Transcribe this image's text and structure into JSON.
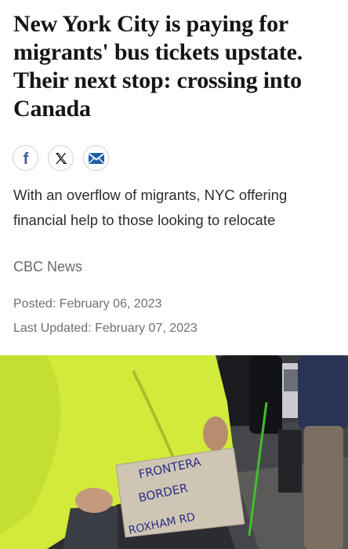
{
  "article": {
    "headline": "New York City is paying for migrants' bus tickets upstate. Their next stop: crossing into Canada",
    "share": [
      {
        "icon": "facebook-icon",
        "label": "f",
        "color": "#3b5998"
      },
      {
        "icon": "x-icon",
        "label": "𝕏",
        "color": "#111111"
      },
      {
        "icon": "email-icon",
        "label": "",
        "color": "#1f5fa8"
      }
    ],
    "deck": "With an overflow of migrants, NYC offering financial help to those looking to relocate",
    "source": "CBC News",
    "posted": "Posted: February 06, 2023",
    "last_updated": "Last Updated: February 07, 2023"
  },
  "photo": {
    "sign_lines": [
      "FRONTERA",
      "BORDER",
      "ROXHAM RD"
    ],
    "colors": {
      "jacket": "#d6ee3a",
      "sign": "#cfc5b5",
      "ink": "#2c2f86",
      "background": "#2b2d30"
    }
  }
}
